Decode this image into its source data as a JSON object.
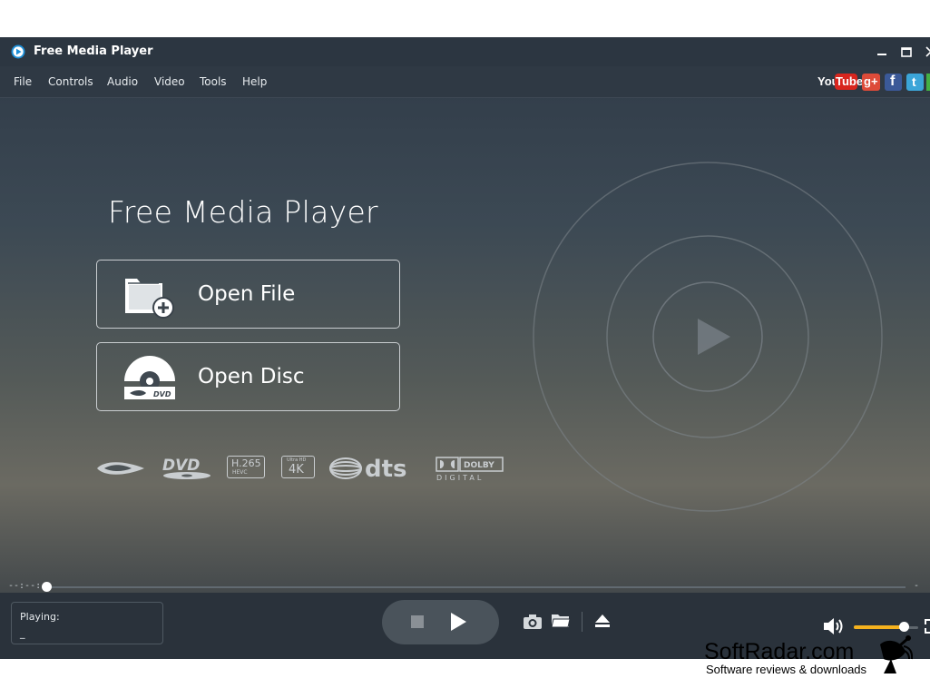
{
  "window": {
    "title": "Free Media Player",
    "controls": {
      "minimize": "—",
      "maximize": "□"
    }
  },
  "menu": {
    "items": [
      "File",
      "Controls",
      "Audio",
      "Video",
      "Tools",
      "Help"
    ]
  },
  "social": {
    "youtube_you": "You",
    "youtube_tube": "Tube",
    "googleplus": "g+",
    "facebook": "f",
    "twitter": "t"
  },
  "home": {
    "title": "Free Media Player",
    "open_file_label": "Open File",
    "open_disc_label": "Open Disc",
    "format_logos": {
      "bluray": "Blu-ray",
      "dvd": "DVD",
      "h265_top": "H.265",
      "h265_bottom": "HEVC",
      "uhd_top": "Ultra HD",
      "uhd_bottom": "4K",
      "dts": "dts",
      "dolby_top": "DOLBY",
      "dolby_bottom": "DIGITAL"
    }
  },
  "playback": {
    "time_elapsed": "--:--:--",
    "time_total": "--:",
    "progress": 0,
    "volume": 0.78,
    "status_label": "Playing:",
    "status_value": "_"
  },
  "colors": {
    "accent": "#f5b21e",
    "background_top": "#2f3a47",
    "bar": "#2a323b"
  },
  "watermark": {
    "main": "SoftRadar.com",
    "sub": "Software reviews & downloads"
  }
}
